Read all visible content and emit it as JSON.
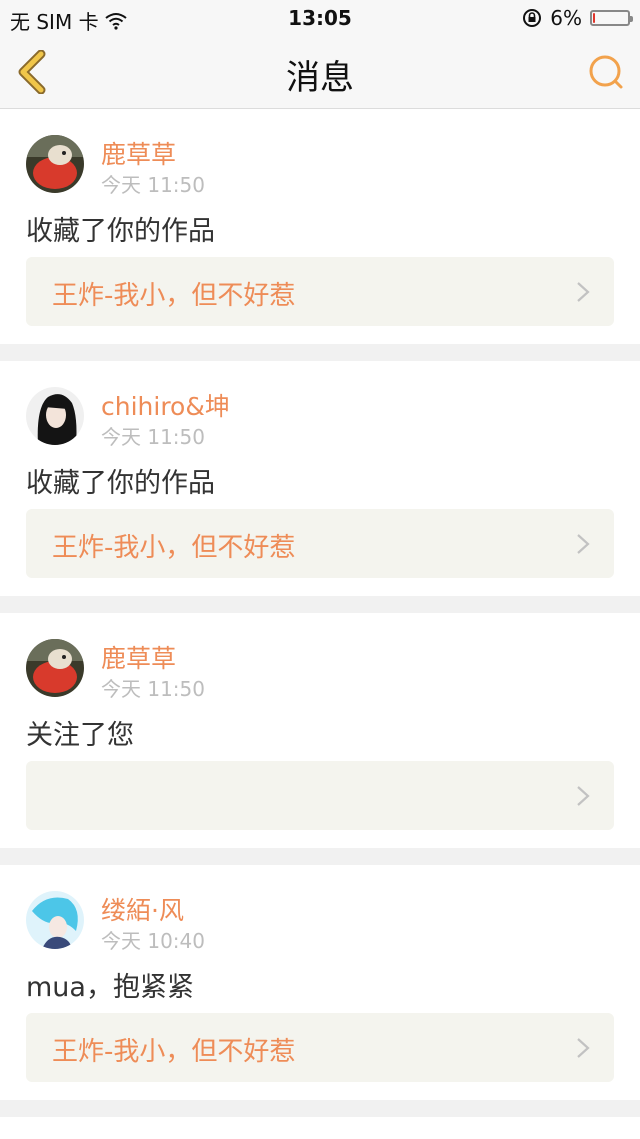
{
  "status_bar": {
    "carrier": "无 SIM 卡",
    "time": "13:05",
    "battery": "6%",
    "battery_level": 0.06,
    "icons": [
      "wifi-icon",
      "orientation-lock-icon",
      "battery-icon"
    ]
  },
  "nav": {
    "title": "消息",
    "back_icon": "back-chevron-icon",
    "search_icon": "search-icon",
    "accent_color": "#f2a24c"
  },
  "messages": [
    {
      "user": "鹿草草",
      "time": "今天 11:50",
      "text": "收藏了你的作品",
      "work": "王炸-我小，但不好惹"
    },
    {
      "user": "chihiro&坤",
      "time": "今天 11:50",
      "text": "收藏了你的作品",
      "work": "王炸-我小，但不好惹"
    },
    {
      "user": "鹿草草",
      "time": "今天 11:50",
      "text": "关注了您",
      "work": ""
    },
    {
      "user": "缕絔·风",
      "time": "今天 10:40",
      "text": "mua，抱紧紧",
      "work": "王炸-我小，但不好惹"
    }
  ],
  "colors": {
    "username": "#ee8c57",
    "work_bg": "#f4f4ee",
    "time_text": "#bdbdbd"
  }
}
